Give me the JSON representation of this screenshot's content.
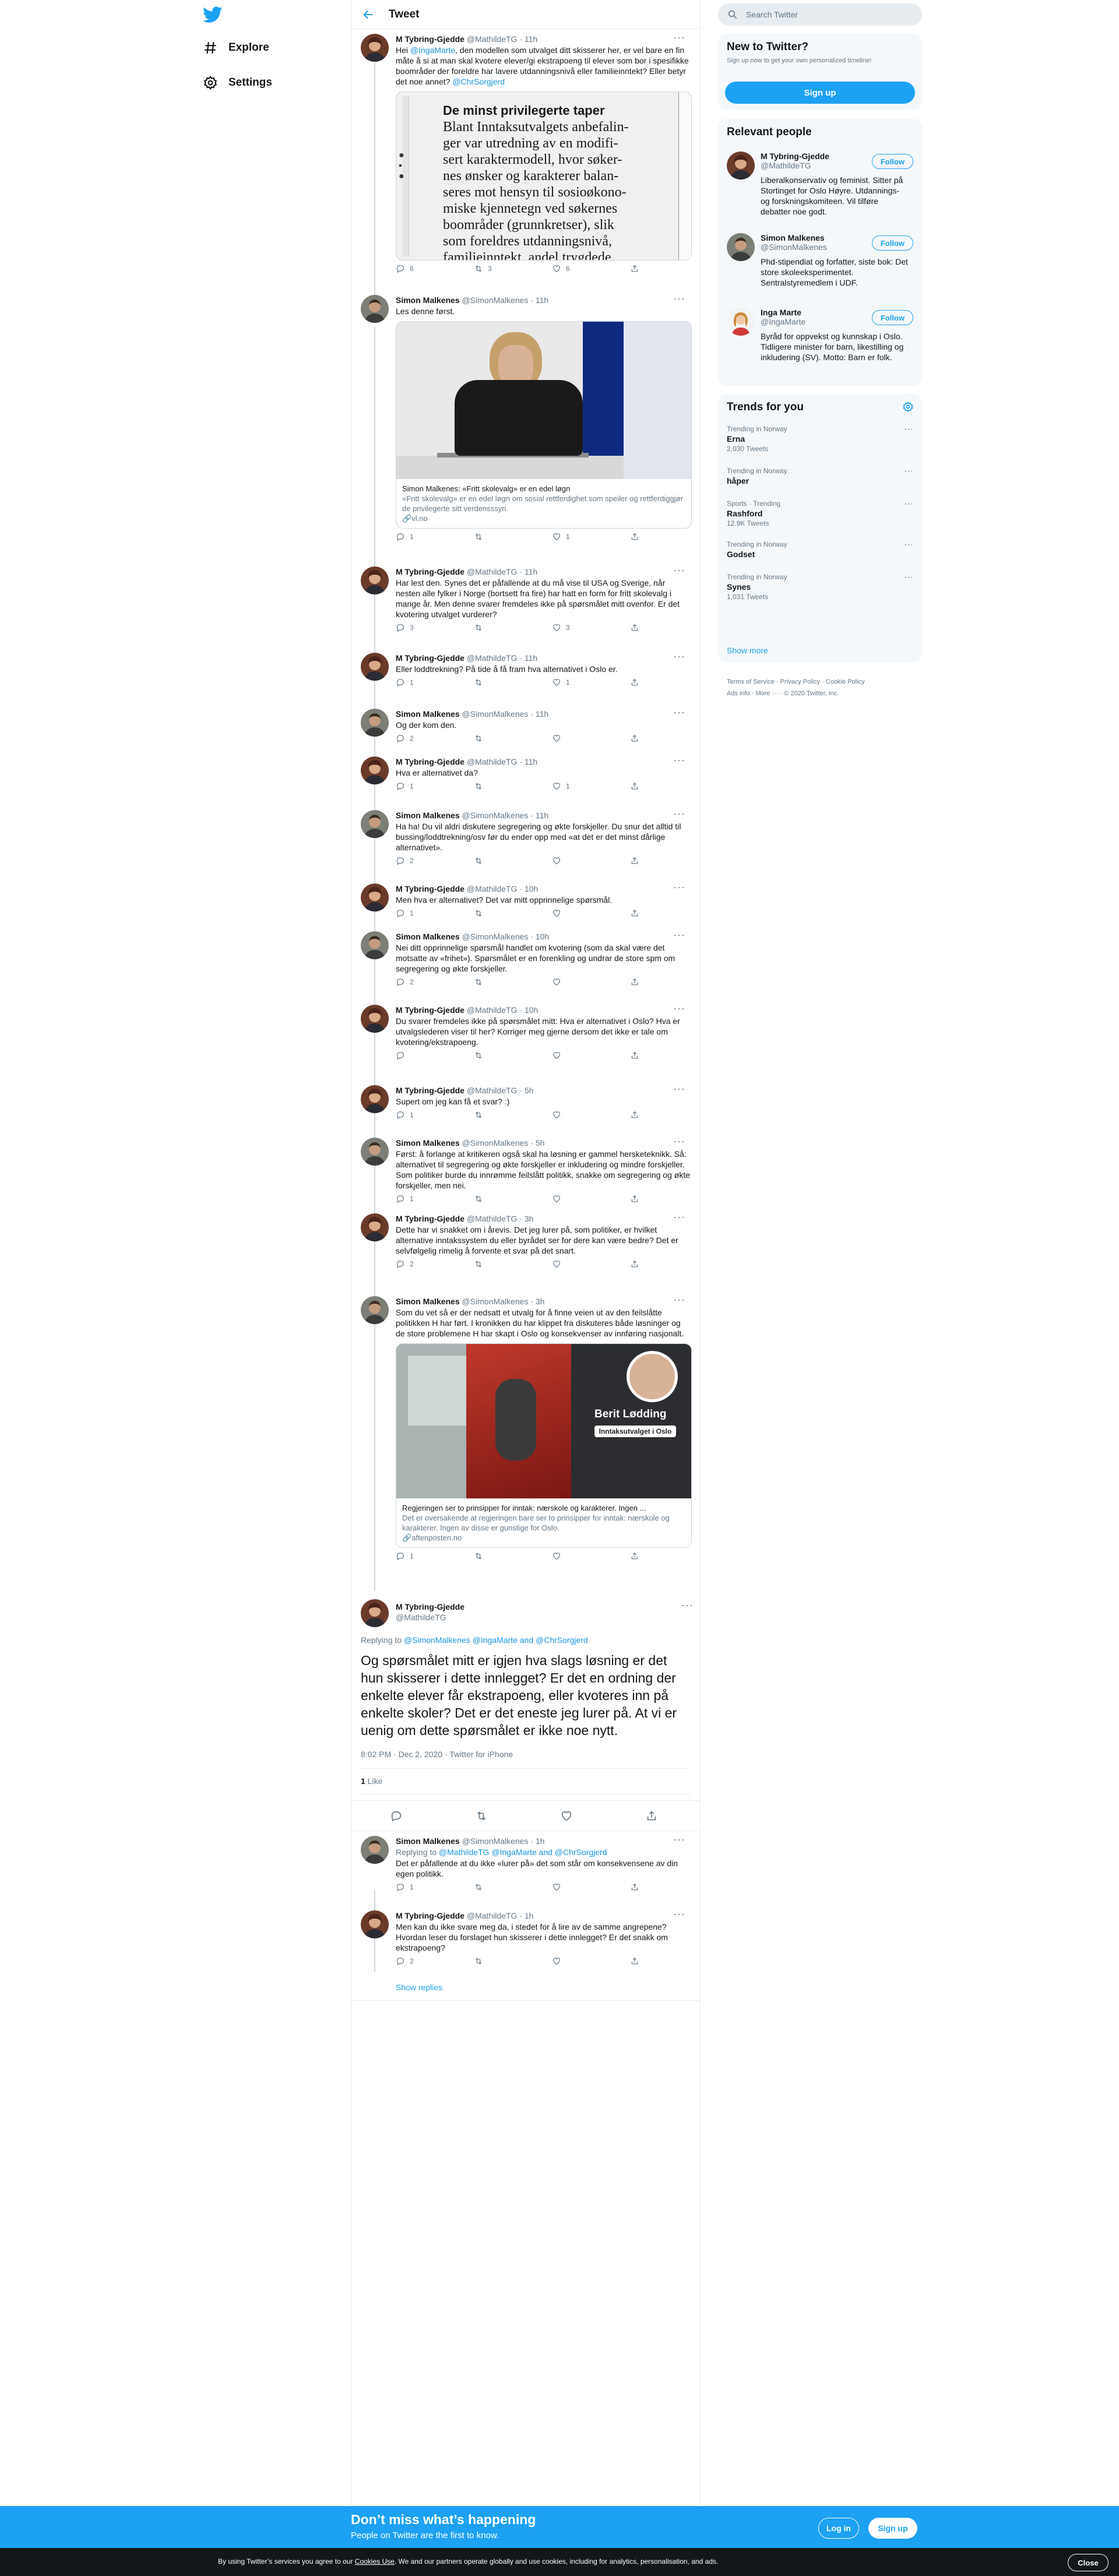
{
  "nav": {
    "explore": "Explore",
    "settings": "Settings"
  },
  "header": {
    "title": "Tweet"
  },
  "search": {
    "placeholder": "Search Twitter"
  },
  "new_to_twitter": {
    "title": "New to Twitter?",
    "subtitle": "Sign up now to get your own personalized timeline!",
    "signup": "Sign up"
  },
  "relevant": {
    "title": "Relevant people",
    "follow": "Follow",
    "people": [
      {
        "name": "M Tybring-Gjedde",
        "handle": "@MathildeTG",
        "bio": "Liberalkonservativ og feminist. Sitter på Stortinget for Oslo Høyre. Utdannings- og forskningskomiteen. Vil tilføre debatter noe godt."
      },
      {
        "name": "Simon Malkenes",
        "handle": "@SimonMalkenes",
        "bio": "Phd-stipendiat og forfatter, siste bok: Det store skoleeksperimentet. Sentralstyremedlem i UDF."
      },
      {
        "name": "Inga Marte",
        "handle": "@IngaMarte",
        "bio": "Byråd for oppvekst og kunnskap i Oslo. Tidligere minister for barn, likestilling og inkludering (SV). Motto: Barn er folk."
      }
    ]
  },
  "trends": {
    "title": "Trends for you",
    "items": [
      {
        "context": "Trending in Norway",
        "name": "Erna",
        "count": "2,030 Tweets"
      },
      {
        "context": "Trending in Norway",
        "name": "håper",
        "count": ""
      },
      {
        "context": "Sports · Trending",
        "name": "Rashford",
        "count": "12.9K Tweets"
      },
      {
        "context": "Trending in Norway",
        "name": "Godset",
        "count": ""
      },
      {
        "context": "Trending in Norway",
        "name": "Synes",
        "count": "1,031 Tweets"
      }
    ],
    "show_more": "Show more"
  },
  "footer": {
    "line1": "Terms of Service · Privacy Policy · Cookie Policy",
    "line2": "Ads info · More ··· · © 2020 Twitter, Inc."
  },
  "tweets": [
    {
      "name": "M Tybring-Gjedde",
      "handle": "@MathildeTG",
      "time": "· 11h",
      "text_a": "Hei ",
      "mention": "@IngaMarte",
      "text_b": ", den modellen som utvalget ditt skisserer her, er vel bare en fin måte å si at man skal kvotere elever/gi ekstrapoeng til elever som bor i spesifikke boområder der foreldre har lavere utdanningsnivå eller familieinntekt? Eller betyr det noe annet? ",
      "mention2": "@ChrSorgjerd",
      "image_text": [
        "De minst privilegerte taper",
        "Blant Inntaksutvalgets anbefalin-",
        "ger var utredning av en modifi-",
        "sert karaktermodell, hvor søker-",
        "nes ønsker og karakterer balan-",
        "seres mot hensyn til sosioøkono-",
        "miske kjennetegn ved søkernes",
        "boområder (grunnkretser), slik",
        "som foreldres utdanningsnivå,",
        "familieinntekt, andel trygdede"
      ],
      "replies": "6",
      "retweets": "3",
      "likes": "6"
    },
    {
      "name": "Simon Malkenes",
      "handle": "@SimonMalkenes",
      "time": "· 11h",
      "text": "Les denne først.",
      "card_title": "Simon Malkenes: «Fritt skolevalg» er en edel løgn",
      "card_desc": "«Fritt skolevalg» er en edel løgn om sosial rettferdighet som speiler og rettferdiggjør de privilegerte sitt verdensssyn.",
      "card_domain": "vl.no",
      "replies": "1",
      "retweets": "",
      "likes": "1"
    },
    {
      "name": "M Tybring-Gjedde",
      "handle": "@MathildeTG",
      "time": "· 11h",
      "text": "Har lest den. Synes det er påfallende at du må vise til USA og Sverige, når nesten alle fylker i Norge (bortsett fra fire) har hatt en form for fritt skolevalg i mange år. Men denne svarer fremdeles ikke på spørsmålet mitt ovenfor. Er det kvotering utvalget vurderer?",
      "replies": "3",
      "retweets": "",
      "likes": "3"
    },
    {
      "name": "M Tybring-Gjedde",
      "handle": "@MathildeTG",
      "time": "· 11h",
      "text": "Eller loddtrekning? På tide å få fram hva alternativet i Oslo er.",
      "replies": "1",
      "retweets": "",
      "likes": "1"
    },
    {
      "name": "Simon Malkenes",
      "handle": "@SimonMalkenes",
      "time": "· 11h",
      "text": "Og der kom den.",
      "replies": "2",
      "retweets": "",
      "likes": ""
    },
    {
      "name": "M Tybring-Gjedde",
      "handle": "@MathildeTG",
      "time": "· 11h",
      "text": "Hva er alternativet da?",
      "replies": "1",
      "retweets": "",
      "likes": "1"
    },
    {
      "name": "Simon Malkenes",
      "handle": "@SimonMalkenes",
      "time": "· 11h",
      "text": "Ha ha! Du vil aldri diskutere segregering og økte forskjeller. Du snur det alltid til bussing/loddtrekning/osv før du ender opp med «at det er det minst dårlige alternativet».",
      "replies": "2",
      "retweets": "",
      "likes": ""
    },
    {
      "name": "M Tybring-Gjedde",
      "handle": "@MathildeTG",
      "time": "· 10h",
      "text": "Men hva er alternativet? Det var mitt opprinnelige spørsmål.",
      "replies": "1",
      "retweets": "",
      "likes": ""
    },
    {
      "name": "Simon Malkenes",
      "handle": "@SimonMalkenes",
      "time": "· 10h",
      "text": "Nei ditt opprinnelige spørsmål handlet om kvotering (som da skal være det motsatte av «frihet»). Spørsmålet er en forenkling og undrar de store spm om segregering og økte forskjeller.",
      "replies": "2",
      "retweets": "",
      "likes": ""
    },
    {
      "name": "M Tybring-Gjedde",
      "handle": "@MathildeTG",
      "time": "· 10h",
      "text": "Du svarer fremdeles ikke på spørsmålet mitt: Hva er alternativet i Oslo? Hva er utvalgslederen viser til her? Korriger meg gjerne dersom det ikke er tale om kvotering/ekstrapoeng.",
      "replies": "",
      "retweets": "",
      "likes": ""
    },
    {
      "name": "M Tybring-Gjedde",
      "handle": "@MathildeTG",
      "time": "· 5h",
      "text": "Supert om jeg kan få et svar? :)",
      "replies": "1",
      "retweets": "",
      "likes": ""
    },
    {
      "name": "Simon Malkenes",
      "handle": "@SimonMalkenes",
      "time": "· 5h",
      "text": "Først: å forlange at kritikeren også skal ha løsning er gammel hersketeknikk. Så: alternativet til segregering og økte forskjeller er inkludering og mindre forskjeller. Som politiker burde du innrømme feilslått politikk, snakke om segregering og økte forskjeller, men nei.",
      "replies": "1",
      "retweets": "",
      "likes": ""
    },
    {
      "name": "M Tybring-Gjedde",
      "handle": "@MathildeTG",
      "time": "· 3h",
      "text": "Dette har vi snakket om i årevis. Det jeg lurer på, som politiker, er hvilket alternative inntakssystem du eller byrådet ser for dere kan være bedre? Det er selvfølgelig rimelig å forvente et svar på det snart.",
      "replies": "2",
      "retweets": "",
      "likes": ""
    },
    {
      "name": "Simon Malkenes",
      "handle": "@SimonMalkenes",
      "time": "· 3h",
      "text": "Som du vet så er der nedsatt et utvalg for å finne veien ut av den feilslåtte politikken H har ført. I kronikken du har klippet fra diskuteres både løsninger og de store problemene H har skapt i Oslo og konsekvenser av innføring nasjonalt.",
      "card_title": "Regjeringen ser to prinsipper for inntak: nærskole og karakterer. Ingen ...",
      "card_desc": "Det er oversakende at regjeringen bare ser to prinsipper for inntak: nærskole og karakterer. Ingen av disse er gunstige for Oslo.",
      "card_domain": "aftenposten.no",
      "overlay_name": "Berit Lødding",
      "overlay_badge": "Inntaksutvalget i Oslo",
      "replies": "1",
      "retweets": "",
      "likes": ""
    }
  ],
  "main_tweet": {
    "name": "M Tybring-Gjedde",
    "handle": "@MathildeTG",
    "replying_prefix": "Replying to ",
    "replying_to": "@SimonMalkenes @IngaMarte and @ChrSorgjerd",
    "text": "Og spørsmålet mitt er igjen hva slags løsning er det hun skisserer i dette innlegget? Er det en ordning der enkelte elever får ekstrapoeng, eller kvoteres inn på enkelte skoler? Det er det eneste jeg lurer på. At vi er uenig om dette spørsmålet er ikke noe nytt.",
    "meta": "8:02 PM · Dec 2, 2020 · Twitter for iPhone",
    "likes_count": "1",
    "likes_label": "Like"
  },
  "replies": [
    {
      "name": "Simon Malkenes",
      "handle": "@SimonMalkenes",
      "time": "· 1h",
      "replying_prefix": "Replying to ",
      "replying_to": "@MathildeTG @IngaMarte and @ChrSorgjerd",
      "text": "Det er påfallende at du ikke «lurer på» det som står om konsekvensene av din egen politikk.",
      "replies": "1",
      "retweets": "",
      "likes": ""
    },
    {
      "name": "M Tybring-Gjedde",
      "handle": "@MathildeTG",
      "time": "· 1h",
      "text": "Men kan du ikke svare meg da, i stedet for å lire av de samme angrepene? Hvordan leser du forslaget hun skisserer i dette innlegget? Er det snakk om ekstrapoeng?",
      "replies": "2",
      "retweets": "",
      "likes": ""
    }
  ],
  "show_replies": "Show replies",
  "bluebar": {
    "title": "Don’t miss what’s happening",
    "subtitle": "People on Twitter are the first to know.",
    "login": "Log in",
    "signup": "Sign up"
  },
  "cookie": {
    "text_a": "By using Twitter’s services you agree to our ",
    "link": "Cookies Use",
    "text_b": ". We and our partners operate globally and use cookies, including for analytics, personalisation, and ads.",
    "close": "Close"
  },
  "colors": {
    "accent": "#1da1f2",
    "text": "#14171a",
    "secondary": "#657786",
    "border": "#e6ecf0"
  }
}
